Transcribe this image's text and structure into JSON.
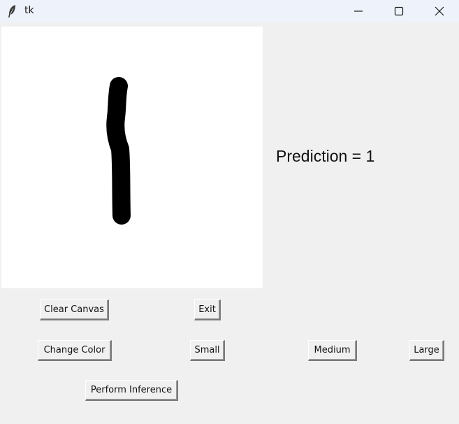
{
  "window": {
    "title": "tk",
    "app_icon": "feather-icon",
    "controls": {
      "minimize_icon": "minimize-icon",
      "maximize_icon": "maximize-icon",
      "close_icon": "close-icon"
    }
  },
  "canvas": {
    "background": "#ffffff",
    "stroke_color": "#000000"
  },
  "prediction": {
    "text": "Prediction = 1"
  },
  "buttons": {
    "clear_canvas": "Clear Canvas",
    "exit": "Exit",
    "change_color": "Change Color",
    "small": "Small",
    "medium": "Medium",
    "large": "Large",
    "perform_inference": "Perform Inference"
  },
  "colors": {
    "window_bg": "#f0f0f0",
    "titlebar_bg": "#eef2fb"
  }
}
